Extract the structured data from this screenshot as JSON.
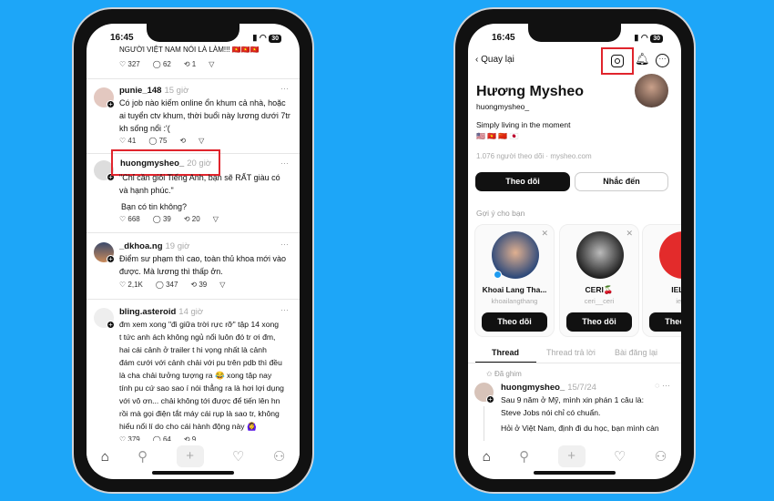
{
  "colors": {
    "background": "#1da6f8",
    "highlight": "#e0242c"
  },
  "left": {
    "status": {
      "time": "16:45",
      "battery": "30"
    },
    "posts": [
      {
        "text": "NGƯỜI VIỆT NAM NÓI LÀ LÀM!!! 🇻🇳🇻🇳🇻🇳",
        "likes": "327",
        "replies": "62",
        "reposts": "1"
      },
      {
        "user": "punie_148",
        "ago": "15 giờ",
        "lines": [
          "Có job nào kiếm online ổn khum cả nhà, hoặc",
          "ai tuyển ctv khum, thời buổi này lương dưới 7tr",
          "kh sống nổi :'("
        ],
        "likes": "41",
        "replies": "75",
        "reposts": ""
      },
      {
        "user": "huongmysheo_",
        "ago": "20 giờ",
        "lines": [
          "\"Chỉ cần giỏi Tiếng Anh, bạn sẽ RẤT giàu có",
          "và hạnh phúc.\""
        ],
        "extra": "Bạn có tin không?",
        "likes": "668",
        "replies": "39",
        "reposts": "20"
      },
      {
        "user": "_dkhoa.ng",
        "ago": "19 giờ",
        "lines": [
          "Điểm sư phạm thì cao, toàn thủ khoa mới vào",
          "được. Mà lương thì thấp ởn."
        ],
        "likes": "2,1K",
        "replies": "347",
        "reposts": "39"
      },
      {
        "user": "bling.asteroid",
        "ago": "14 giờ",
        "lines": [
          "đm xem xong \"đi giữa trời rực rỡ\" tập 14 xong",
          "t tức anh ách không ngủ nổi luôn đó tr ơi đm,",
          "hai cái cảnh ở trailer t hi vọng nhất là cảnh",
          "đám cưới với cảnh chải với pu trên pdb thì đều",
          "là cha chải tưởng tượng ra 😂 xong tập nay",
          "tính pu cứ sao sao í nói thẳng ra là hơi lợi dụng",
          "với vô ơn... chải không tới được để tiến lên hn",
          "rồi mà gọi điện tắt máy cái rụp là sao tr, không",
          "hiểu nổi lí do cho cái hành động này 🙆‍♀️"
        ],
        "likes": "379",
        "replies": "64",
        "reposts": "9"
      }
    ]
  },
  "right": {
    "status": {
      "time": "16:45",
      "battery": "30"
    },
    "back_label": "Quay lại",
    "name": "Hương Mysheo",
    "handle": "huongmysheo_",
    "bio": "Simply living in the moment",
    "flags": "🇺🇸 🇻🇳 🇨🇳 🇯🇵",
    "meta": "1.076 người theo dõi · mysheo.com",
    "follow_label": "Theo dõi",
    "mention_label": "Nhắc đến",
    "suggest_title": "Gợi ý cho bạn",
    "suggestions": [
      {
        "name": "Khoai Lang Tha...",
        "handle": "khoailangthang",
        "button": "Theo dõi"
      },
      {
        "name": "CERI🍒",
        "handle": "ceri__ceri",
        "button": "Theo dõi"
      },
      {
        "name": "IELTS",
        "handle": "ielts",
        "button": "Theo dõi"
      }
    ],
    "tabs": [
      "Thread",
      "Thread trả lời",
      "Bài đăng lại"
    ],
    "pinned_label": "Đã ghim",
    "post": {
      "user": "huongmysheo_",
      "date": "15/7/24",
      "lines": [
        "Sau 9 năm ở Mỹ, mình xin phán 1 câu là:",
        "Steve Jobs nói chỉ có chuẩn."
      ],
      "more": "Hỏi ở Việt Nam, định đi du học, bạn mình càn"
    }
  }
}
